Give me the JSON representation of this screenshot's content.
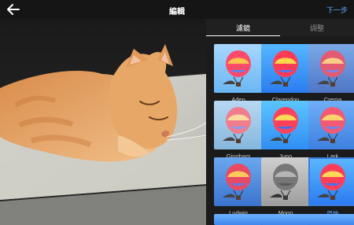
{
  "header": {
    "title": "編輯",
    "next_label": "下一步"
  },
  "tabs": [
    {
      "label": "濾鏡"
    },
    {
      "label": "調整"
    }
  ],
  "filters": [
    {
      "name": "Aden"
    },
    {
      "name": "Clarendon"
    },
    {
      "name": "Crema"
    },
    {
      "name": "Gingham"
    },
    {
      "name": "Juno"
    },
    {
      "name": "Lark"
    },
    {
      "name": "Ludwig"
    },
    {
      "name": "Moon"
    },
    {
      "name": "原始"
    }
  ],
  "colors": {
    "accent": "#5aa7ff",
    "selected_border": "#3b7be0"
  }
}
